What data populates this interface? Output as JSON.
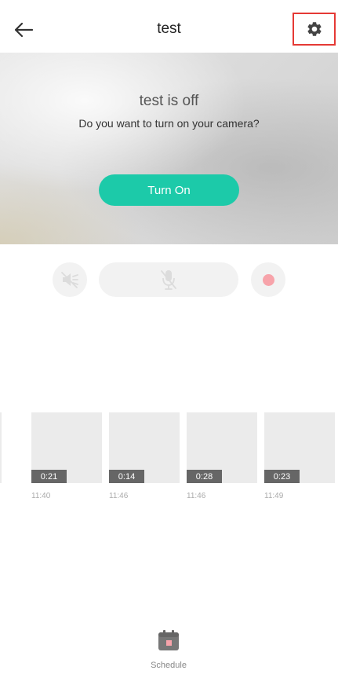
{
  "header": {
    "title": "test",
    "back_icon": "arrow-left-icon",
    "settings_icon": "gear-icon"
  },
  "preview": {
    "status_title": "test is off",
    "prompt": "Do you want to turn on your camera?",
    "turn_on_label": "Turn On",
    "accent_color": "#1ccaa9"
  },
  "controls": {
    "mute_icon": "speaker-muted-icon",
    "mic_icon": "microphone-muted-icon",
    "record_icon": "record-dot-icon"
  },
  "clips": [
    {
      "duration": "0:21",
      "time": "11:40"
    },
    {
      "duration": "0:14",
      "time": "11:46"
    },
    {
      "duration": "0:28",
      "time": "11:46"
    },
    {
      "duration": "0:23",
      "time": "11:49"
    }
  ],
  "bottom_nav": {
    "schedule_label": "Schedule",
    "schedule_icon": "calendar-icon"
  }
}
